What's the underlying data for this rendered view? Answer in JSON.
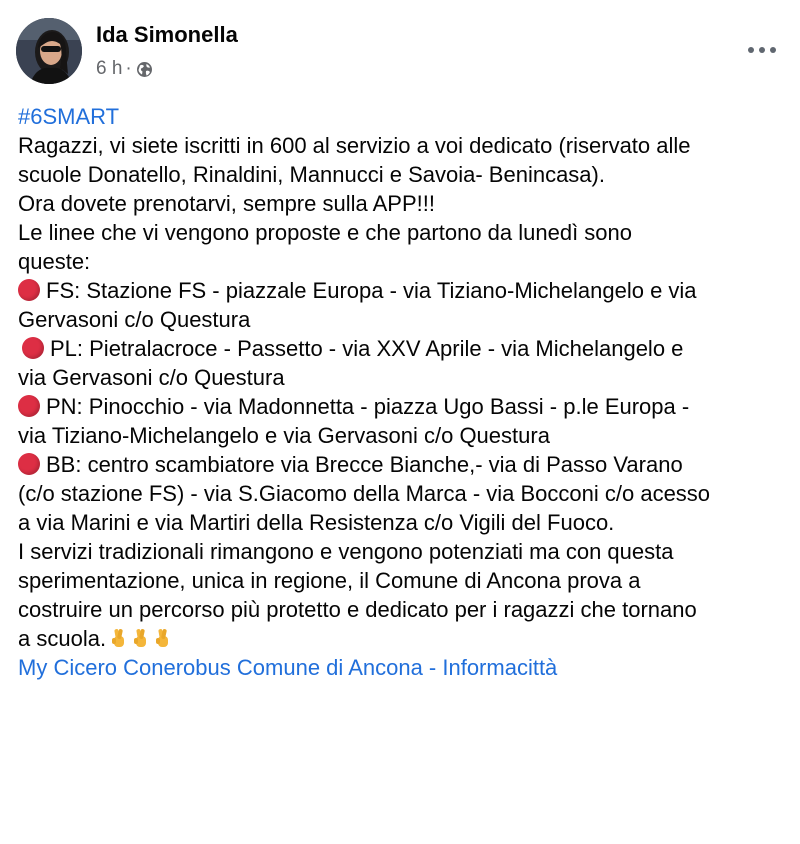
{
  "post": {
    "author": "Ida Simonella",
    "time": "6 h",
    "separator": "·",
    "privacy_icon": "globe-icon",
    "more_icon": "more-options-icon",
    "hashtag": "#6SMART",
    "intro_lines": [
      "Ragazzi, vi siete iscritti in 600  al servizio a voi dedicato  (riservato alle",
      "scuole Donatello, Rinaldini, Mannucci e Savoia- Benincasa).",
      "Ora dovete prenotarvi, sempre sulla APP!!!"
    ],
    "lines_intro": [
      "Le linee che vi vengono proposte e che partono da lunedì sono",
      "queste:"
    ],
    "routes": [
      {
        "icon": "red-circle-icon",
        "lines": [
          "FS: Stazione FS - piazzale Europa - via Tiziano-Michelangelo e via",
          "Gervasoni c/o Questura"
        ]
      },
      {
        "icon": "red-circle-icon",
        "lines": [
          "PL: Pietralacroce - Passetto - via XXV Aprile - via Michelangelo e",
          "via Gervasoni c/o Questura"
        ]
      },
      {
        "icon": "red-circle-icon",
        "lines": [
          "PN: Pinocchio - via Madonnetta - piazza Ugo Bassi - p.le Europa -",
          "via Tiziano-Michelangelo e via Gervasoni c/o Questura"
        ]
      },
      {
        "icon": "red-circle-icon",
        "lines": [
          "BB: centro scambiatore  via Brecce Bianche,- via di Passo Varano",
          "(c/o stazione FS) - via S.Giacomo della Marca - via Bocconi c/o acesso",
          "a via Marini e via Martiri della Resistenza c/o Vigili del Fuoco."
        ]
      }
    ],
    "closing_lines": [
      "I servizi tradizionali rimangono e vengono potenziati ma con questa",
      "sperimentazione, unica in regione, il Comune di Ancona prova a",
      "costruire un percorso più protetto e dedicato per i ragazzi che tornano",
      "a scuola."
    ],
    "closing_emoji": [
      "crossed-fingers-icon",
      "crossed-fingers-icon",
      "crossed-fingers-icon"
    ],
    "tags": [
      "My Cicero",
      "Conerobus",
      "Comune di Ancona - Informacittà"
    ],
    "colors": {
      "link": "#216fdb",
      "meta": "#65676b",
      "text": "#050505",
      "red_circle": "#dd2e44"
    }
  }
}
